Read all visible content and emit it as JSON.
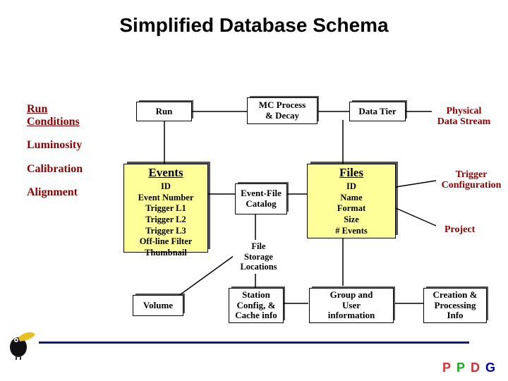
{
  "title": "Simplified Database Schema",
  "sidebar": {
    "items": [
      "Run Conditions",
      "Luminosity",
      "Calibration",
      "Alignment"
    ]
  },
  "boxes": {
    "run": {
      "label": "Run"
    },
    "mc": {
      "l1": "MC Process",
      "l2": "& Decay"
    },
    "datatier": {
      "label": "Data Tier"
    },
    "events": {
      "head": "Events",
      "lines": [
        "ID",
        "Event Number",
        "Trigger L1",
        "Trigger L2",
        "Trigger L3",
        "Off-line Filter",
        "Thumbnail"
      ]
    },
    "files": {
      "head": "Files",
      "lines": [
        "ID",
        "Name",
        "Format",
        "Size",
        "# Events"
      ]
    },
    "efcatalog": {
      "l1": "Event-File",
      "l2": "Catalog"
    },
    "storage": {
      "l1": "File",
      "l2": "Storage",
      "l3": "Locations"
    },
    "volume": {
      "label": "Volume"
    },
    "station": {
      "l1": "Station",
      "l2": "Config, &",
      "l3": "Cache info"
    },
    "groupuser": {
      "l1": "Group and",
      "l2": "User",
      "l3": "information"
    },
    "creation": {
      "l1": "Creation &",
      "l2": "Processing",
      "l3": "Info"
    }
  },
  "rightLabels": {
    "physical": {
      "l1": "Physical",
      "l2": "Data Stream"
    },
    "trigger": {
      "l1": "Trigger",
      "l2": "Configuration"
    },
    "project": "Project"
  },
  "logo": {
    "p1": "P",
    "p2": "P",
    "d": "D",
    "g": "G"
  }
}
